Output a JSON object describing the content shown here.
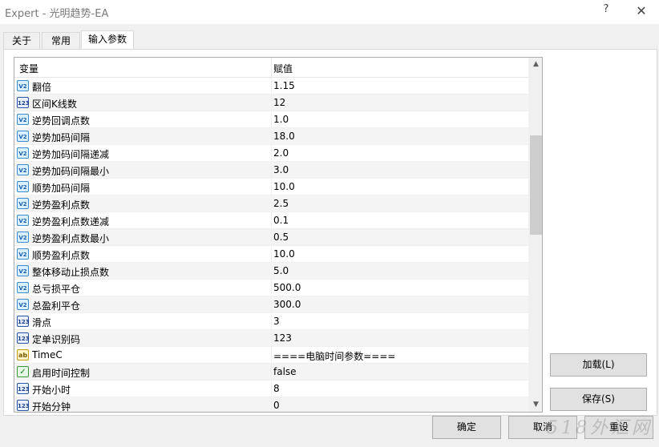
{
  "window": {
    "title": "Expert - 光明趋势-EA",
    "help_glyph": "?",
    "close_glyph": "✕"
  },
  "tabs": [
    {
      "label": "关于"
    },
    {
      "label": "常用"
    },
    {
      "label": "输入参数"
    }
  ],
  "grid": {
    "col_variable": "变量",
    "col_value": "赋值",
    "rows": [
      {
        "icon": "v2",
        "name": "翻倍",
        "value": "1.15"
      },
      {
        "icon": "n123",
        "name": "区间K线数",
        "value": "12"
      },
      {
        "icon": "v2",
        "name": "逆势回调点数",
        "value": "1.0"
      },
      {
        "icon": "v2",
        "name": "逆势加码间隔",
        "value": "18.0"
      },
      {
        "icon": "v2",
        "name": "逆势加码间隔递减",
        "value": "2.0"
      },
      {
        "icon": "v2",
        "name": "逆势加码间隔最小",
        "value": "3.0"
      },
      {
        "icon": "v2",
        "name": "顺势加码间隔",
        "value": "10.0"
      },
      {
        "icon": "v2",
        "name": "逆势盈利点数",
        "value": "2.5"
      },
      {
        "icon": "v2",
        "name": "逆势盈利点数递减",
        "value": "0.1"
      },
      {
        "icon": "v2",
        "name": "逆势盈利点数最小",
        "value": "0.5"
      },
      {
        "icon": "v2",
        "name": "顺势盈利点数",
        "value": "10.0"
      },
      {
        "icon": "v2",
        "name": "整体移动止损点数",
        "value": "5.0"
      },
      {
        "icon": "v2",
        "name": "总亏损平仓",
        "value": "500.0"
      },
      {
        "icon": "v2",
        "name": "总盈利平仓",
        "value": "300.0"
      },
      {
        "icon": "n123",
        "name": "滑点",
        "value": "3"
      },
      {
        "icon": "n123",
        "name": "定单识别码",
        "value": "123"
      },
      {
        "icon": "ab",
        "name": "TimeC",
        "value": "====电脑时间参数===="
      },
      {
        "icon": "chk",
        "name": "启用时间控制",
        "value": "false"
      },
      {
        "icon": "n123",
        "name": "开始小时",
        "value": "8"
      },
      {
        "icon": "n123",
        "name": "开始分钟",
        "value": "0"
      }
    ],
    "icon_text": {
      "v2": "V2",
      "n123": "123",
      "ab": "ab",
      "chk": "✓"
    },
    "scroll_up": "▲",
    "scroll_down": "▼"
  },
  "buttons": {
    "load": "加载(L)",
    "save": "保存(S)",
    "ok": "确定",
    "cancel": "取消",
    "reset": "重设"
  },
  "watermark": "518外汇网"
}
